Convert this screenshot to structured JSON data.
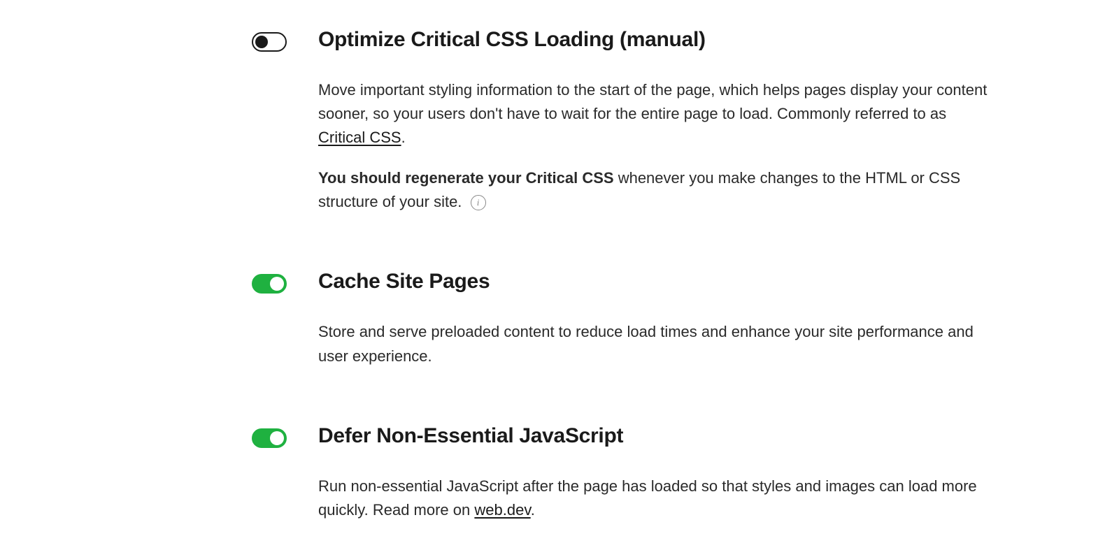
{
  "settings": [
    {
      "id": "optimize-css",
      "enabled": false,
      "title": "Optimize Critical CSS Loading (manual)",
      "desc1_pre": "Move important styling information to the start of the page, which helps pages display your content sooner, so your users don't have to wait for the entire page to load. Commonly referred to as ",
      "desc1_link": "Critical CSS",
      "desc1_post": ".",
      "desc2_bold": "You should regenerate your Critical CSS",
      "desc2_rest": " whenever you make changes to the HTML or CSS structure of your site. ",
      "info_label": "i"
    },
    {
      "id": "cache-pages",
      "enabled": true,
      "title": "Cache Site Pages",
      "desc1": "Store and serve preloaded content to reduce load times and enhance your site performance and user experience."
    },
    {
      "id": "defer-js",
      "enabled": true,
      "title": "Defer Non-Essential JavaScript",
      "desc1_pre": "Run non-essential JavaScript after the page has loaded so that styles and images can load more quickly. Read more on ",
      "desc1_link": "web.dev",
      "desc1_post": "."
    }
  ]
}
